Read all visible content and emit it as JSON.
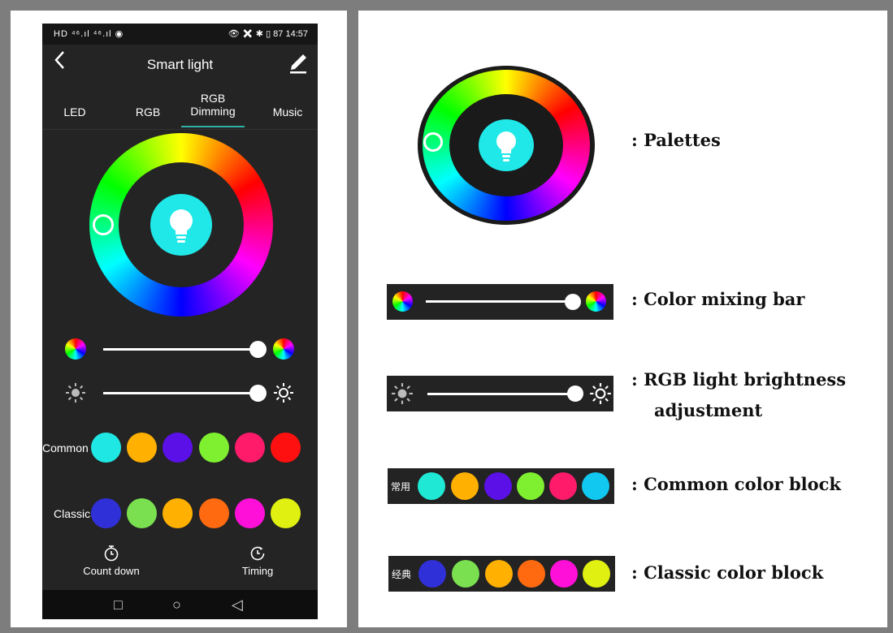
{
  "phone": {
    "status_left": "HD ⁴⁶.ıl ⁴⁶.ıl ◉",
    "status_right": "👁 ✖ ✱ ▯ 87 14:57",
    "title": "Smart light",
    "back_icon": "chevron-left-icon",
    "edit_icon": "pencil-icon",
    "tabs": [
      {
        "label": "LED"
      },
      {
        "label": "RGB"
      },
      {
        "label": "RGB",
        "label2": "Dimming",
        "active": true
      },
      {
        "label": "Music"
      }
    ],
    "mix_slider": {
      "value_fraction": 0.95
    },
    "brightness_slider": {
      "value_fraction": 0.95
    },
    "common": {
      "label": "Common",
      "colors": [
        "#1fe8e4",
        "#ffb000",
        "#5a10e6",
        "#7ef030",
        "#ff1a6a",
        "#ff1010"
      ]
    },
    "classic": {
      "label": "Classic",
      "colors": [
        "#3030d8",
        "#7ae050",
        "#ffb000",
        "#ff6a10",
        "#ff10d8",
        "#e0f010"
      ]
    },
    "bottom_nav": [
      {
        "label": "Count down",
        "icon": "stopwatch-icon"
      },
      {
        "label": "Timing",
        "icon": "clock-icon"
      }
    ],
    "system_nav": [
      "□",
      "○",
      "◁"
    ]
  },
  "legend": {
    "palettes": ": Palettes",
    "color_mixing": ": Color mixing bar",
    "brightness_line1": ": RGB light brightness",
    "brightness_line2": "adjustment",
    "common_block": ": Common color block",
    "classic_block": ": Classic color block",
    "common_strip_label": "常用",
    "classic_strip_label": "经典",
    "common_strip_colors": [
      "#1fe8d4",
      "#ffb000",
      "#5a10e6",
      "#7ef030",
      "#ff1a6a",
      "#10c8f0"
    ],
    "classic_strip_colors": [
      "#3030d8",
      "#7ae050",
      "#ffb000",
      "#ff6a10",
      "#ff10d8",
      "#e0f010"
    ]
  }
}
